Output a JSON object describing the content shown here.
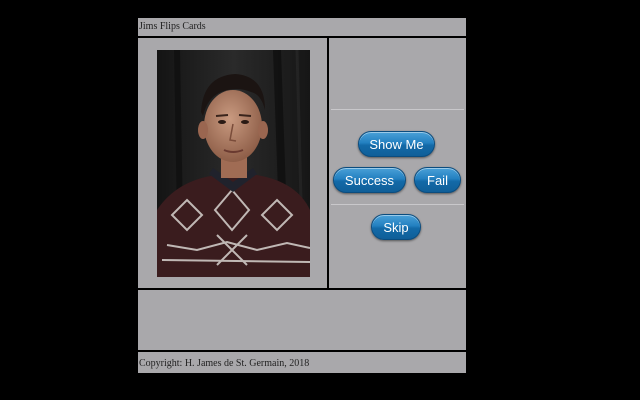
{
  "app": {
    "title": "Jims Flips Cards"
  },
  "card": {
    "photo_icon": "portrait-photo"
  },
  "controls": {
    "show_me_label": "Show Me",
    "success_label": "Success",
    "fail_label": "Fail",
    "skip_label": "Skip",
    "button_color": "#1a75b5"
  },
  "footer": {
    "copyright": "Copyright: H. James de St. Germain, 2018"
  },
  "colors": {
    "page_background": "#000000",
    "panel_background": "#a9a8ab"
  }
}
